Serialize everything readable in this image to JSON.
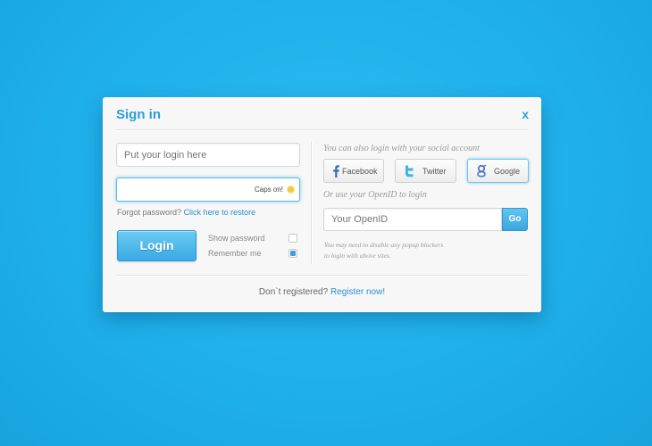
{
  "dialog": {
    "title": "Sign in",
    "close_label": "x"
  },
  "left": {
    "login_placeholder": "Put your login here",
    "password_value": "",
    "caps_warning": "Caps on!",
    "forgot_text": "Forgot password?",
    "forgot_link": "Click here to restore",
    "login_button": "Login",
    "show_password_label": "Show password",
    "show_password_checked": false,
    "remember_label": "Remember me",
    "remember_checked": true
  },
  "right": {
    "social_caption": "You can also login with your social account",
    "social_buttons": [
      {
        "label": "Facebook",
        "icon": "facebook-icon"
      },
      {
        "label": "Twitter",
        "icon": "twitter-icon"
      },
      {
        "label": "Google",
        "icon": "google-icon"
      }
    ],
    "openid_caption": "Or use your OpenID to login",
    "openid_placeholder": "Your OpenID",
    "go_button": "Go",
    "popup_note_line1": "You may need to disable any popup blockers",
    "popup_note_line2": "to login with above sites."
  },
  "footer": {
    "text": "Don`t registered?",
    "link": "Register now!"
  },
  "colors": {
    "background": "#1fb0ea",
    "accent": "#2a9fd8",
    "caps_indicator": "#f5c93a"
  }
}
